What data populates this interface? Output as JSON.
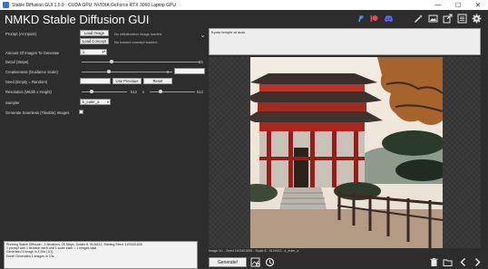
{
  "window": {
    "title": "Stable Diffusion GUI 1.5.0 - CUDA GPU: NVIDIA GeForce RTX 3060 Laptop GPU",
    "minimize": "—",
    "maximize": "☐",
    "close": "✕"
  },
  "app_title": "NMKD Stable Diffusion GUI",
  "toolbar": {
    "icons": [
      "paypal-icon",
      "patreon-icon",
      "discord-icon",
      "magic-wand-icon",
      "image-viewer-icon",
      "export-icon",
      "list-icon",
      "gear-icon"
    ]
  },
  "prompt": {
    "label": "Prompt (AI Inputs)",
    "value": "Kyoto temple at dusk"
  },
  "init_image": {
    "button": "Load Image",
    "note": "No initialization image loaded."
  },
  "concept": {
    "button": "Load Concept",
    "note": "No trained concept loaded."
  },
  "images_to_generate": {
    "label": "Amount Of Images To Generate",
    "value": "1"
  },
  "steps": {
    "label": "Detail (Steps)",
    "value": "25",
    "fraction": 0.25
  },
  "scale": {
    "label": "Creativeness (Guidance Scale)",
    "value": "8",
    "fraction": 0.3
  },
  "seed": {
    "label": "Seed (Empty = Random)",
    "use_previous": "Use Previous",
    "reset": "Reset"
  },
  "resolution": {
    "label": "Resolution (Width x Height)",
    "width": "512",
    "x": "x",
    "height": "512"
  },
  "sampler": {
    "label": "Sampler",
    "value": "k_euler_a"
  },
  "seamless": {
    "label": "Generate Seamless (Tileable) Images"
  },
  "image_info": "Image 1/1 - Seed 1103401836 - Scale 8 - 512x512 - k_euler_a",
  "log": [
    "Running Stable Diffusion - 1 Iterations, 25 Steps, Scales 8, 512x512, Starting Seed: 1103401836",
    "1 prompt with 1 iteration each and 1 scale each = 1 images total.",
    "Generated 1 image in 4.95s (1/1)",
    "Done! Generated 1 images in 10s."
  ],
  "generate_button": "Generate!",
  "bottom_icons": [
    "add-image-icon",
    "history-icon",
    "trash-icon",
    "folder-icon",
    "previous-icon",
    "next-icon"
  ]
}
